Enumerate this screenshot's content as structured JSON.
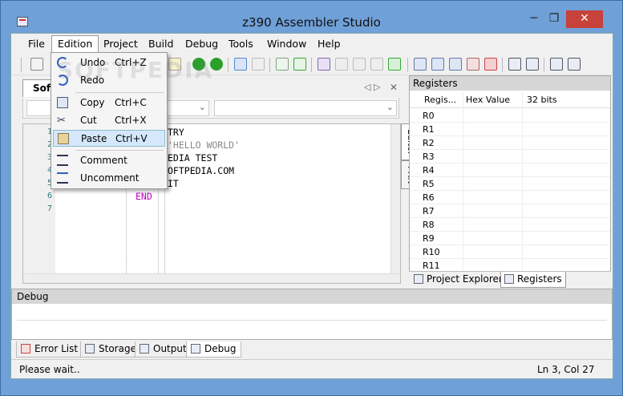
{
  "window": {
    "title": "z390 Assembler Studio",
    "min": "─",
    "max": "❐",
    "close": "✕"
  },
  "menu": [
    "File",
    "Edition",
    "Project",
    "Build",
    "Debug",
    "Tools",
    "Window",
    "Help"
  ],
  "doc_tab": {
    "label": "Soft",
    "pin": "◁ ▷",
    "close": "✕"
  },
  "editor": {
    "line_numbers": [
      "1",
      "2",
      "3",
      "4",
      "5",
      "6",
      "7"
    ],
    "lines": [
      "TRY",
      "'HELLO WORLD'",
      "EDIA TEST",
      "OFTPEDIA.COM",
      "IT",
      "END"
    ]
  },
  "side_tabs": [
    "Editor",
    "PRN"
  ],
  "registers": {
    "title": "Registers",
    "columns": [
      "Regis...",
      "Hex Value",
      "32 bits"
    ],
    "rows": [
      "R0",
      "R1",
      "R2",
      "R3",
      "R4",
      "R5",
      "R6",
      "R7",
      "R8",
      "R9",
      "R10",
      "R11"
    ]
  },
  "right_tabs": [
    "Project Explorer",
    "Registers"
  ],
  "debug": {
    "title": "Debug"
  },
  "bottom_tabs": [
    "Error List",
    "Storage",
    "Output",
    "Debug"
  ],
  "status": {
    "left": "Please wait..",
    "right": "Ln 3, Col 27"
  },
  "edition_menu": [
    {
      "label": "Undo",
      "key": "Ctrl+Z",
      "icon": "undo-icon"
    },
    {
      "label": "Redo",
      "key": "",
      "icon": "redo-icon"
    },
    {
      "label": "Copy",
      "key": "Ctrl+C",
      "icon": "copy-icon"
    },
    {
      "label": "Cut",
      "key": "Ctrl+X",
      "icon": "cut-icon"
    },
    {
      "label": "Paste",
      "key": "Ctrl+V",
      "icon": "paste-icon"
    },
    {
      "label": "Comment",
      "key": "",
      "icon": "comment-icon"
    },
    {
      "label": "Uncomment",
      "key": "",
      "icon": "uncomment-icon"
    }
  ],
  "watermark": "SOFTPEDIA"
}
